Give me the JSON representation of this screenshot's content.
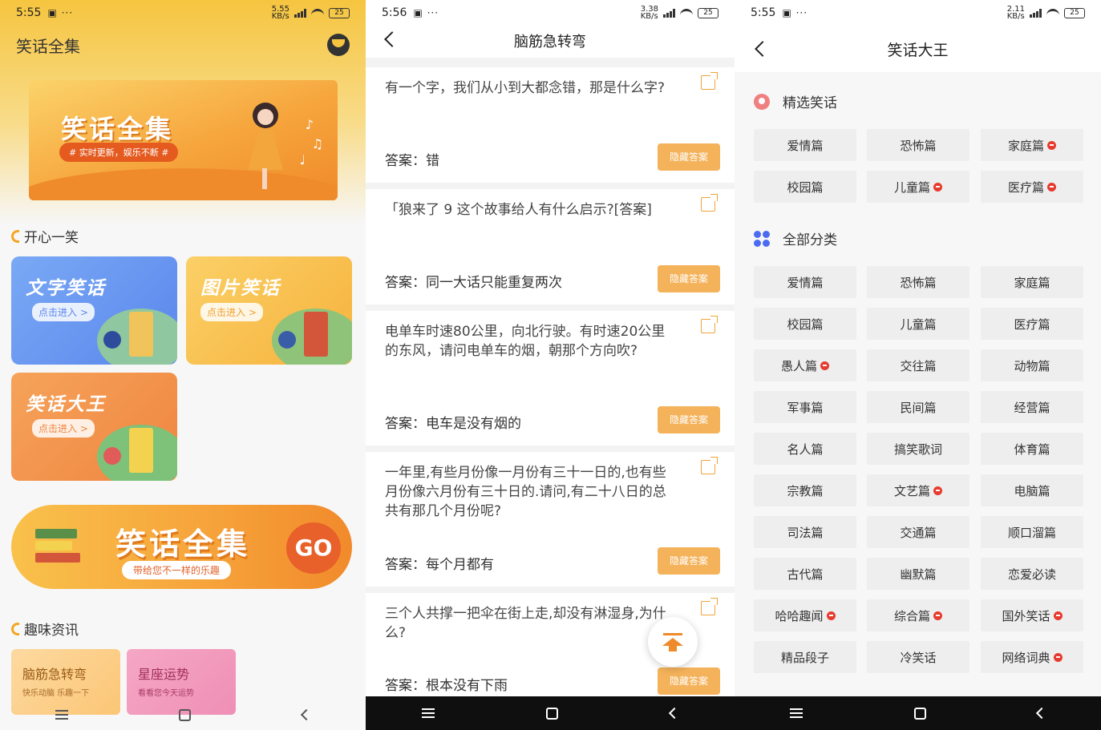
{
  "screen1": {
    "status": {
      "time": "5:55",
      "net": "5.55\nKB/s",
      "battery": "25"
    },
    "app_title": "笑话全集",
    "banner": {
      "title": "笑话全集",
      "subtitle": "# 实时更新，娱乐不断 #"
    },
    "section_happy": "开心一笑",
    "cards": [
      {
        "title": "文字笑话",
        "enter": "点击进入 >"
      },
      {
        "title": "图片笑话",
        "enter": "点击进入 >"
      },
      {
        "title": "笑话大王",
        "enter": "点击进入 >"
      }
    ],
    "go_banner": {
      "title": "笑话全集",
      "subtitle": "带给您不一样的乐趣",
      "go": "GO"
    },
    "section_info": "趣味资讯",
    "info_cards": [
      {
        "title": "脑筋急转弯",
        "desc": "快乐动脑 乐趣一下"
      },
      {
        "title": "星座运势",
        "desc": "看看您今天运势"
      }
    ]
  },
  "screen2": {
    "status": {
      "time": "5:56",
      "net": "3.38\nKB/s",
      "battery": "25"
    },
    "title": "脑筋急转弯",
    "hide_label": "隐藏答案",
    "items": [
      {
        "q": "有一个字，我们从小到大都念错，那是什么字?",
        "a": "答案：错"
      },
      {
        "q": "「狼来了 9 这个故事给人有什么启示?[答案]",
        "a": "答案：同一大话只能重复两次"
      },
      {
        "q": "电单车时速80公里，向北行驶。有时速20公里的东风，请问电单车的烟，朝那个方向吹?",
        "a": "答案：电车是没有烟的"
      },
      {
        "q": "一年里,有些月份像一月份有三十一日的,也有些月份像六月份有三十日的.请问,有二十八日的总共有那几个月份呢?",
        "a": "答案：每个月都有"
      },
      {
        "q": "三个人共撑一把伞在街上走,却没有淋湿身,为什么?",
        "a": "答案：根本没有下雨"
      }
    ]
  },
  "screen3": {
    "status": {
      "time": "5:55",
      "net": "2.11\nKB/s",
      "battery": "25"
    },
    "title": "笑话大王",
    "featured_title": "精选笑话",
    "featured": [
      {
        "label": "爱情篇",
        "hot": false
      },
      {
        "label": "恐怖篇",
        "hot": false
      },
      {
        "label": "家庭篇",
        "hot": true
      },
      {
        "label": "校园篇",
        "hot": false
      },
      {
        "label": "儿童篇",
        "hot": true
      },
      {
        "label": "医疗篇",
        "hot": true
      }
    ],
    "all_title": "全部分类",
    "all": [
      {
        "label": "爱情篇",
        "hot": false
      },
      {
        "label": "恐怖篇",
        "hot": false
      },
      {
        "label": "家庭篇",
        "hot": false
      },
      {
        "label": "校园篇",
        "hot": false
      },
      {
        "label": "儿童篇",
        "hot": false
      },
      {
        "label": "医疗篇",
        "hot": false
      },
      {
        "label": "愚人篇",
        "hot": true
      },
      {
        "label": "交往篇",
        "hot": false
      },
      {
        "label": "动物篇",
        "hot": false
      },
      {
        "label": "军事篇",
        "hot": false
      },
      {
        "label": "民间篇",
        "hot": false
      },
      {
        "label": "经营篇",
        "hot": false
      },
      {
        "label": "名人篇",
        "hot": false
      },
      {
        "label": "搞笑歌词",
        "hot": false
      },
      {
        "label": "体育篇",
        "hot": false
      },
      {
        "label": "宗教篇",
        "hot": false
      },
      {
        "label": "文艺篇",
        "hot": true
      },
      {
        "label": "电脑篇",
        "hot": false
      },
      {
        "label": "司法篇",
        "hot": false
      },
      {
        "label": "交通篇",
        "hot": false
      },
      {
        "label": "顺口溜篇",
        "hot": false
      },
      {
        "label": "古代篇",
        "hot": false
      },
      {
        "label": "幽默篇",
        "hot": false
      },
      {
        "label": "恋爱必读",
        "hot": false
      },
      {
        "label": "哈哈趣闻",
        "hot": true
      },
      {
        "label": "综合篇",
        "hot": true
      },
      {
        "label": "国外笑话",
        "hot": true
      },
      {
        "label": "精品段子",
        "hot": false
      },
      {
        "label": "冷笑话",
        "hot": false
      },
      {
        "label": "网络词典",
        "hot": true
      }
    ]
  },
  "colors": {
    "accent": "#f4a623",
    "hide_button": "#f4b25a",
    "hot": "#e63b2e",
    "nav_dark": "#0f0f0f"
  }
}
